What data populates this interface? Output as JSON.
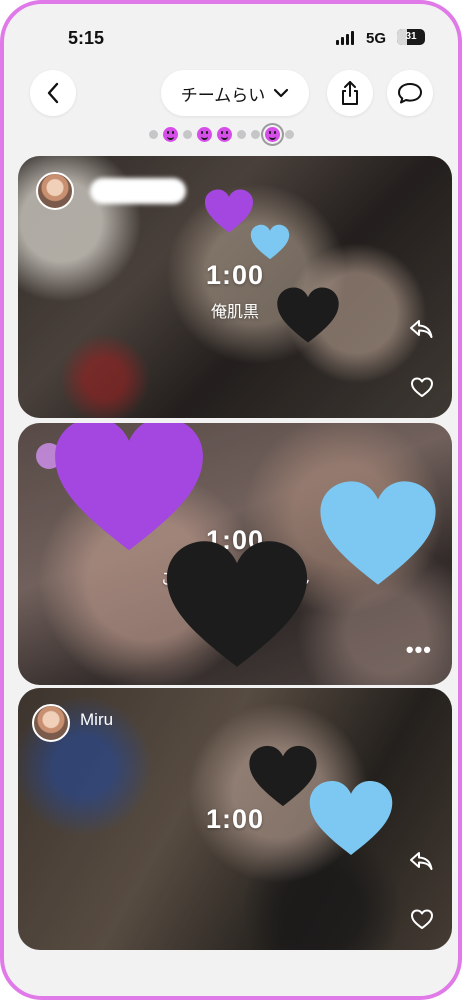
{
  "status_bar": {
    "time": "5:15",
    "network": "5G",
    "battery": "31"
  },
  "header": {
    "back_icon": "chevron-left-icon",
    "team_label": "チームらい",
    "dropdown_icon": "chevron-down-icon",
    "share_icon": "share-icon",
    "chat_icon": "chat-bubble-icon"
  },
  "pager": [
    "dot",
    "smile",
    "dot",
    "smile",
    "smile",
    "dot",
    "dot",
    "smile-active",
    "dot"
  ],
  "posts": [
    {
      "author": "",
      "duration": "1:00",
      "caption": "俺肌黒",
      "actions": [
        "reply-icon",
        "heart-icon"
      ]
    },
    {
      "author": "",
      "duration": "1:00",
      "caption": "こいつ            ーやん",
      "actions": [
        "more-icon"
      ],
      "more_label": "•••"
    },
    {
      "author": "Miru",
      "duration": "1:00",
      "caption": "",
      "actions": [
        "reply-icon",
        "heart-icon"
      ]
    }
  ],
  "colors": {
    "frame_border": "#e07ae8",
    "accent_purple": "#d64ee8",
    "heart_purple": "#a447e0",
    "heart_blue": "#7cc8f2",
    "heart_black": "#1c1c1c"
  }
}
